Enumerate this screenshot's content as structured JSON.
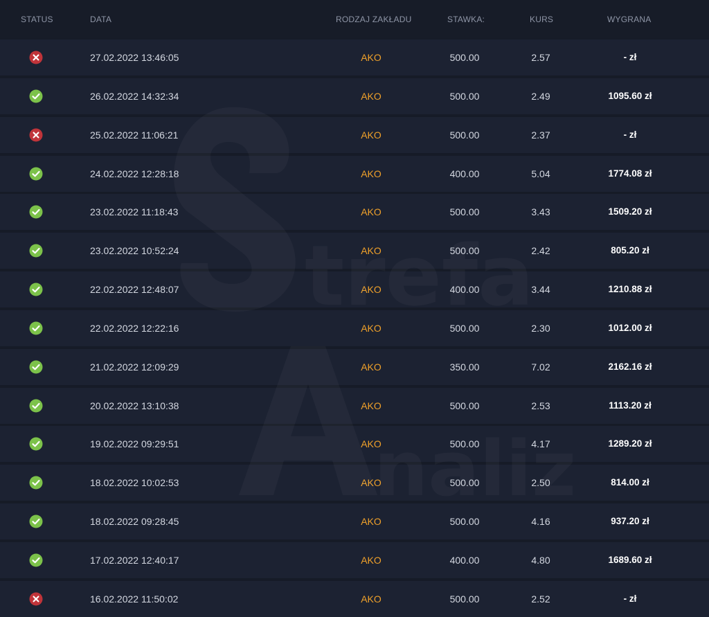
{
  "header": {
    "status": "STATUS",
    "date": "DATA",
    "type": "RODZAJ ZAKŁADU",
    "stake": "STAWKA:",
    "odds": "KURS",
    "win": "WYGRANA"
  },
  "colors": {
    "won": "#7cc24a",
    "lost": "#c0343a",
    "bet_type": "#f0a12a",
    "background": "#161b27",
    "row": "#1c2232"
  },
  "rows": [
    {
      "status": "lost",
      "status_icon": "x-circle-icon",
      "date": "27.02.2022 13:46:05",
      "type": "AKO",
      "stake": "500.00",
      "odds": "2.57",
      "win": "- zł"
    },
    {
      "status": "won",
      "status_icon": "check-circle-icon",
      "date": "26.02.2022 14:32:34",
      "type": "AKO",
      "stake": "500.00",
      "odds": "2.49",
      "win": "1095.60 zł"
    },
    {
      "status": "lost",
      "status_icon": "x-circle-icon",
      "date": "25.02.2022 11:06:21",
      "type": "AKO",
      "stake": "500.00",
      "odds": "2.37",
      "win": "- zł"
    },
    {
      "status": "won",
      "status_icon": "check-circle-icon",
      "date": "24.02.2022 12:28:18",
      "type": "AKO",
      "stake": "400.00",
      "odds": "5.04",
      "win": "1774.08 zł"
    },
    {
      "status": "won",
      "status_icon": "check-circle-icon",
      "date": "23.02.2022 11:18:43",
      "type": "AKO",
      "stake": "500.00",
      "odds": "3.43",
      "win": "1509.20 zł"
    },
    {
      "status": "won",
      "status_icon": "check-circle-icon",
      "date": "23.02.2022 10:52:24",
      "type": "AKO",
      "stake": "500.00",
      "odds": "2.42",
      "win": "805.20 zł"
    },
    {
      "status": "won",
      "status_icon": "check-circle-icon",
      "date": "22.02.2022 12:48:07",
      "type": "AKO",
      "stake": "400.00",
      "odds": "3.44",
      "win": "1210.88 zł"
    },
    {
      "status": "won",
      "status_icon": "check-circle-icon",
      "date": "22.02.2022 12:22:16",
      "type": "AKO",
      "stake": "500.00",
      "odds": "2.30",
      "win": "1012.00 zł"
    },
    {
      "status": "won",
      "status_icon": "check-circle-icon",
      "date": "21.02.2022 12:09:29",
      "type": "AKO",
      "stake": "350.00",
      "odds": "7.02",
      "win": "2162.16 zł"
    },
    {
      "status": "won",
      "status_icon": "check-circle-icon",
      "date": "20.02.2022 13:10:38",
      "type": "AKO",
      "stake": "500.00",
      "odds": "2.53",
      "win": "1113.20 zł"
    },
    {
      "status": "won",
      "status_icon": "check-circle-icon",
      "date": "19.02.2022 09:29:51",
      "type": "AKO",
      "stake": "500.00",
      "odds": "4.17",
      "win": "1289.20 zł"
    },
    {
      "status": "won",
      "status_icon": "check-circle-icon",
      "date": "18.02.2022 10:02:53",
      "type": "AKO",
      "stake": "500.00",
      "odds": "2.50",
      "win": "814.00 zł"
    },
    {
      "status": "won",
      "status_icon": "check-circle-icon",
      "date": "18.02.2022 09:28:45",
      "type": "AKO",
      "stake": "500.00",
      "odds": "4.16",
      "win": "937.20 zł"
    },
    {
      "status": "won",
      "status_icon": "check-circle-icon",
      "date": "17.02.2022 12:40:17",
      "type": "AKO",
      "stake": "400.00",
      "odds": "4.80",
      "win": "1689.60 zł"
    },
    {
      "status": "lost",
      "status_icon": "x-circle-icon",
      "date": "16.02.2022 11:50:02",
      "type": "AKO",
      "stake": "500.00",
      "odds": "2.52",
      "win": "- zł"
    }
  ],
  "watermark": {
    "line1": "trefa",
    "line2": "naliz"
  }
}
